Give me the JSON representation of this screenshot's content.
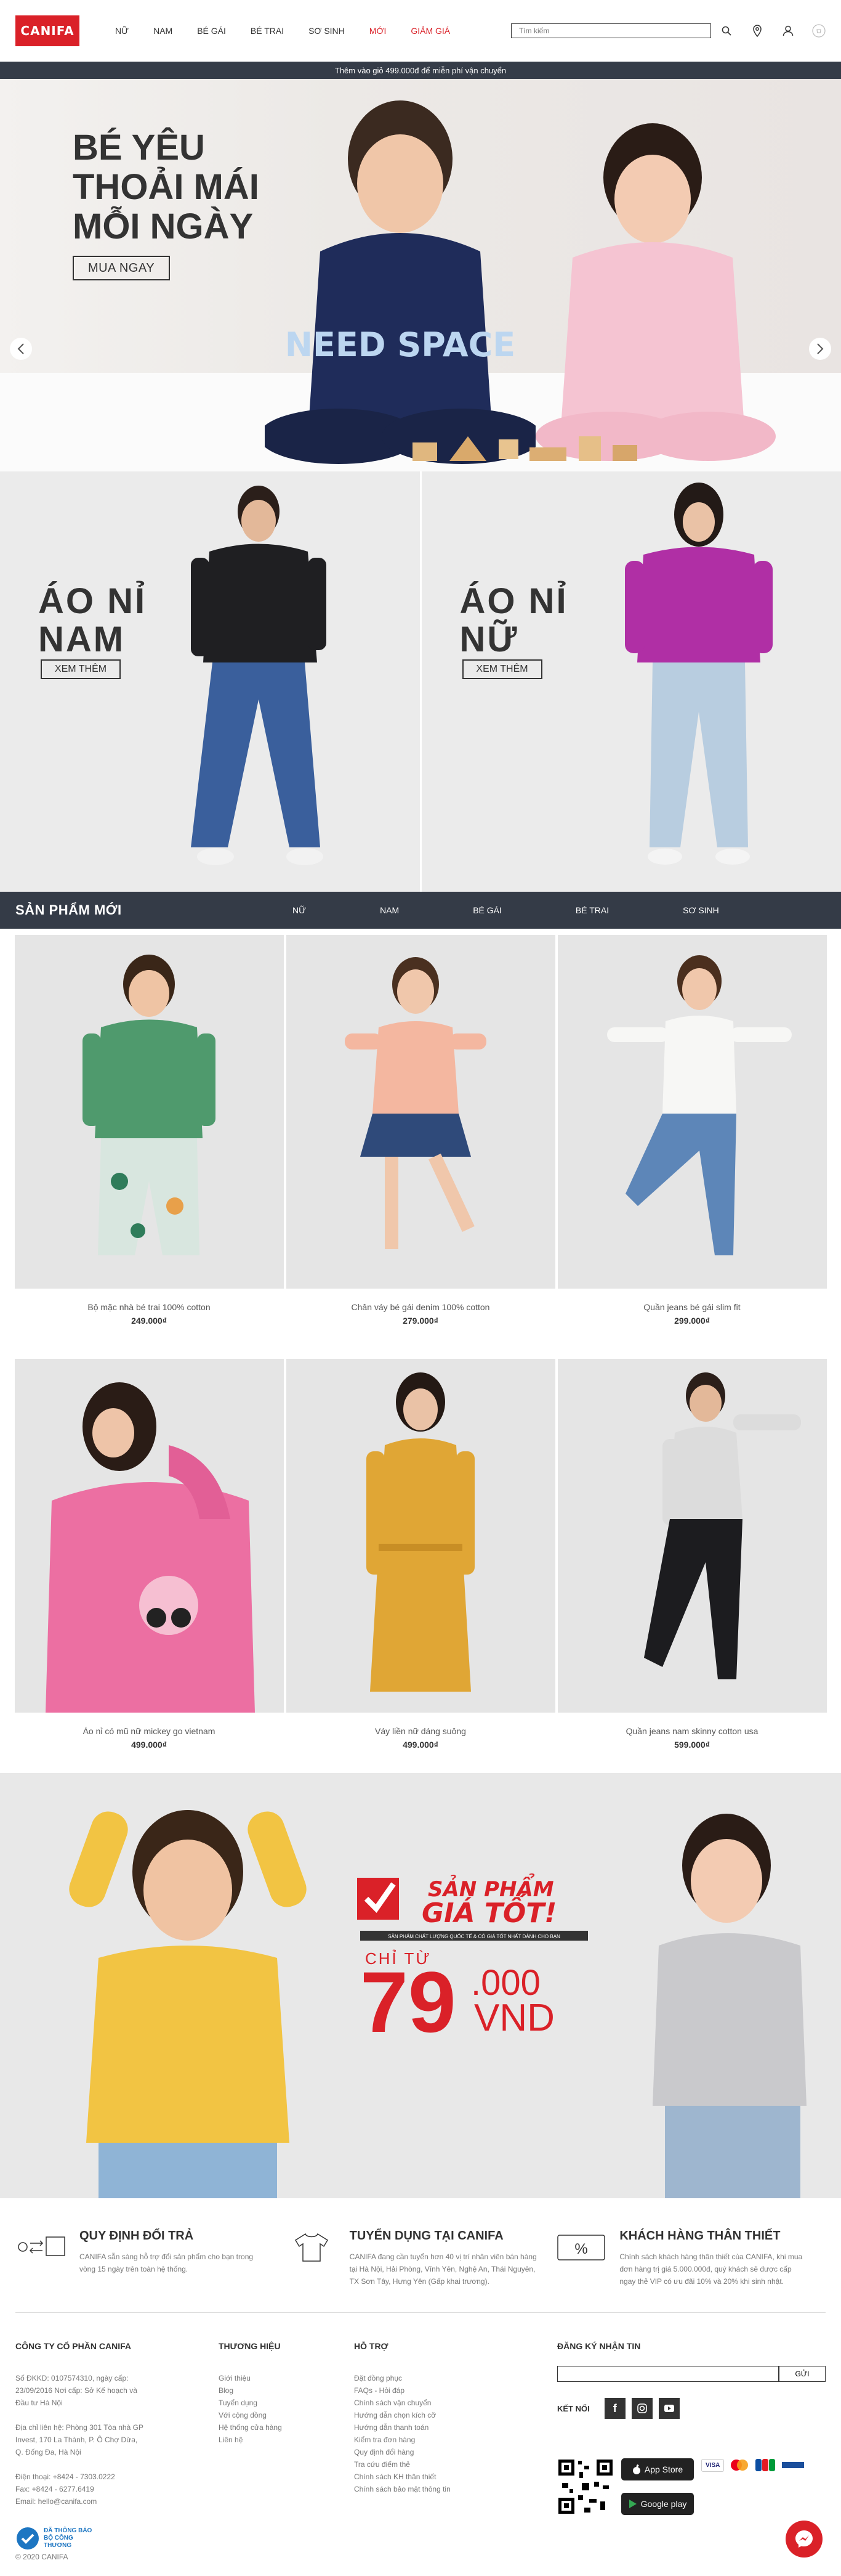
{
  "header": {
    "logo": "CANIFA",
    "nav": [
      "NỮ",
      "NAM",
      "BÉ GÁI",
      "BÉ TRAI",
      "SƠ SINH",
      "MỚI",
      "GIẢM GIÁ"
    ],
    "search_placeholder": "Tìm kiếm"
  },
  "promo_bar": "Thêm vào giỏ 499.000đ để miễn phí vận chuyển",
  "hero": {
    "title_line1": "BÉ YÊU",
    "title_line2": "THOẢI MÁI",
    "title_line3": "MỖI NGÀY",
    "cta": "MUA NGAY",
    "shirt_text": "NEED SPACE"
  },
  "split": {
    "left_title_l1": "ÁO NỈ",
    "left_title_l2": "NAM",
    "left_cta": "XEM THÊM",
    "right_title_l1": "ÁO NỈ",
    "right_title_l2": "NỮ",
    "right_cta": "XEM THÊM"
  },
  "new_products": {
    "title": "SẢN PHẨM MỚI",
    "tabs": [
      "NỮ",
      "NAM",
      "BÉ GÁI",
      "BÉ TRAI",
      "SƠ SINH"
    ]
  },
  "products": [
    {
      "name": "Bộ mặc nhà bé trai 100% cotton",
      "price": "249.000₫"
    },
    {
      "name": "Chân váy bé gái denim 100% cotton",
      "price": "279.000₫"
    },
    {
      "name": "Quần jeans bé gái slim fit",
      "price": "299.000₫"
    },
    {
      "name": "Áo nỉ có mũ nữ mickey go vietnam",
      "price": "499.000₫"
    },
    {
      "name": "Váy liền nữ dáng suông",
      "price": "499.000₫"
    },
    {
      "name": "Quần jeans nam skinny cotton usa",
      "price": "599.000₫"
    }
  ],
  "banner": {
    "headline_l1": "SẢN PHẨM",
    "headline_l2": "GIÁ TỐT!",
    "tagline": "SẢN PHẨM CHẤT LƯỢNG QUỐC TẾ & CÓ GIÁ TỐT NHẤT DÀNH CHO BẠN",
    "from": "CHỈ TỪ",
    "price_big": "79",
    "price_small": ".000",
    "currency": "VND"
  },
  "services": [
    {
      "title": "QUY ĐỊNH ĐỔI TRẢ",
      "text": "CANIFA sẵn sàng hỗ trợ đổi sản phẩm cho bạn trong vòng 15 ngày trên toàn hệ thống."
    },
    {
      "title": "TUYỂN DỤNG TẠI CANIFA",
      "text": "CANIFA đang cần tuyển hơn 40 vị trí nhân viên bán hàng tại Hà Nội, Hải Phòng, Vĩnh Yên, Nghệ An, Thái Nguyên, TX Sơn Tây, Hưng Yên (Gấp khai trương)."
    },
    {
      "title": "KHÁCH HÀNG THÂN THIẾT",
      "text": "Chính sách khách hàng thân thiết của CANIFA, khi mua đơn hàng trị giá 5.000.000đ, quý khách sẽ được cấp ngay thẻ VIP có ưu đãi 10% và 20% khi sinh nhật."
    }
  ],
  "footer": {
    "company_title": "CÔNG TY CỔ PHẦN CANIFA",
    "company_lines": [
      "Số ĐKKD: 0107574310, ngày cấp: 23/09/2016 Nơi cấp: Sở Kế hoạch và Đầu tư Hà Nội",
      "Địa chỉ liên hệ: Phòng 301 Tòa nhà GP Invest, 170 La Thành, P. Ô Chợ Dừa, Q. Đống Đa, Hà Nội",
      "Điện thoại: +8424 - 7303.0222",
      "Fax: +8424 - 6277.6419",
      "Email: hello@canifa.com"
    ],
    "brand_title": "THƯƠNG HIỆU",
    "brand_links": [
      "Giới thiệu",
      "Blog",
      "Tuyển dụng",
      "Với cộng đồng",
      "Hệ thống cửa hàng",
      "Liên hệ"
    ],
    "support_title": "HỖ TRỢ",
    "support_links": [
      "Đặt đồng phục",
      "FAQs - Hỏi đáp",
      "Chính sách vận chuyển",
      "Hướng dẫn chọn kích cỡ",
      "Hướng dẫn thanh toán",
      "Kiểm tra đơn hàng",
      "Quy định đổi hàng",
      "Tra cứu điểm thẻ",
      "Chính sách KH thân thiết",
      "Chính sách bảo mật thông tin"
    ],
    "newsletter_title": "ĐĂNG KÝ NHẬN TIN",
    "newsletter_button": "GỬI",
    "social_label": "KẾT NỐI",
    "app_store": "App Store",
    "google_play": "Google play",
    "registered": "ĐÃ THÔNG BÁO BỘ CÔNG THƯƠNG",
    "copyright": "© 2020 CANIFA"
  },
  "colors": {
    "brand_red": "#da2128",
    "dark_bar": "#343b47"
  }
}
